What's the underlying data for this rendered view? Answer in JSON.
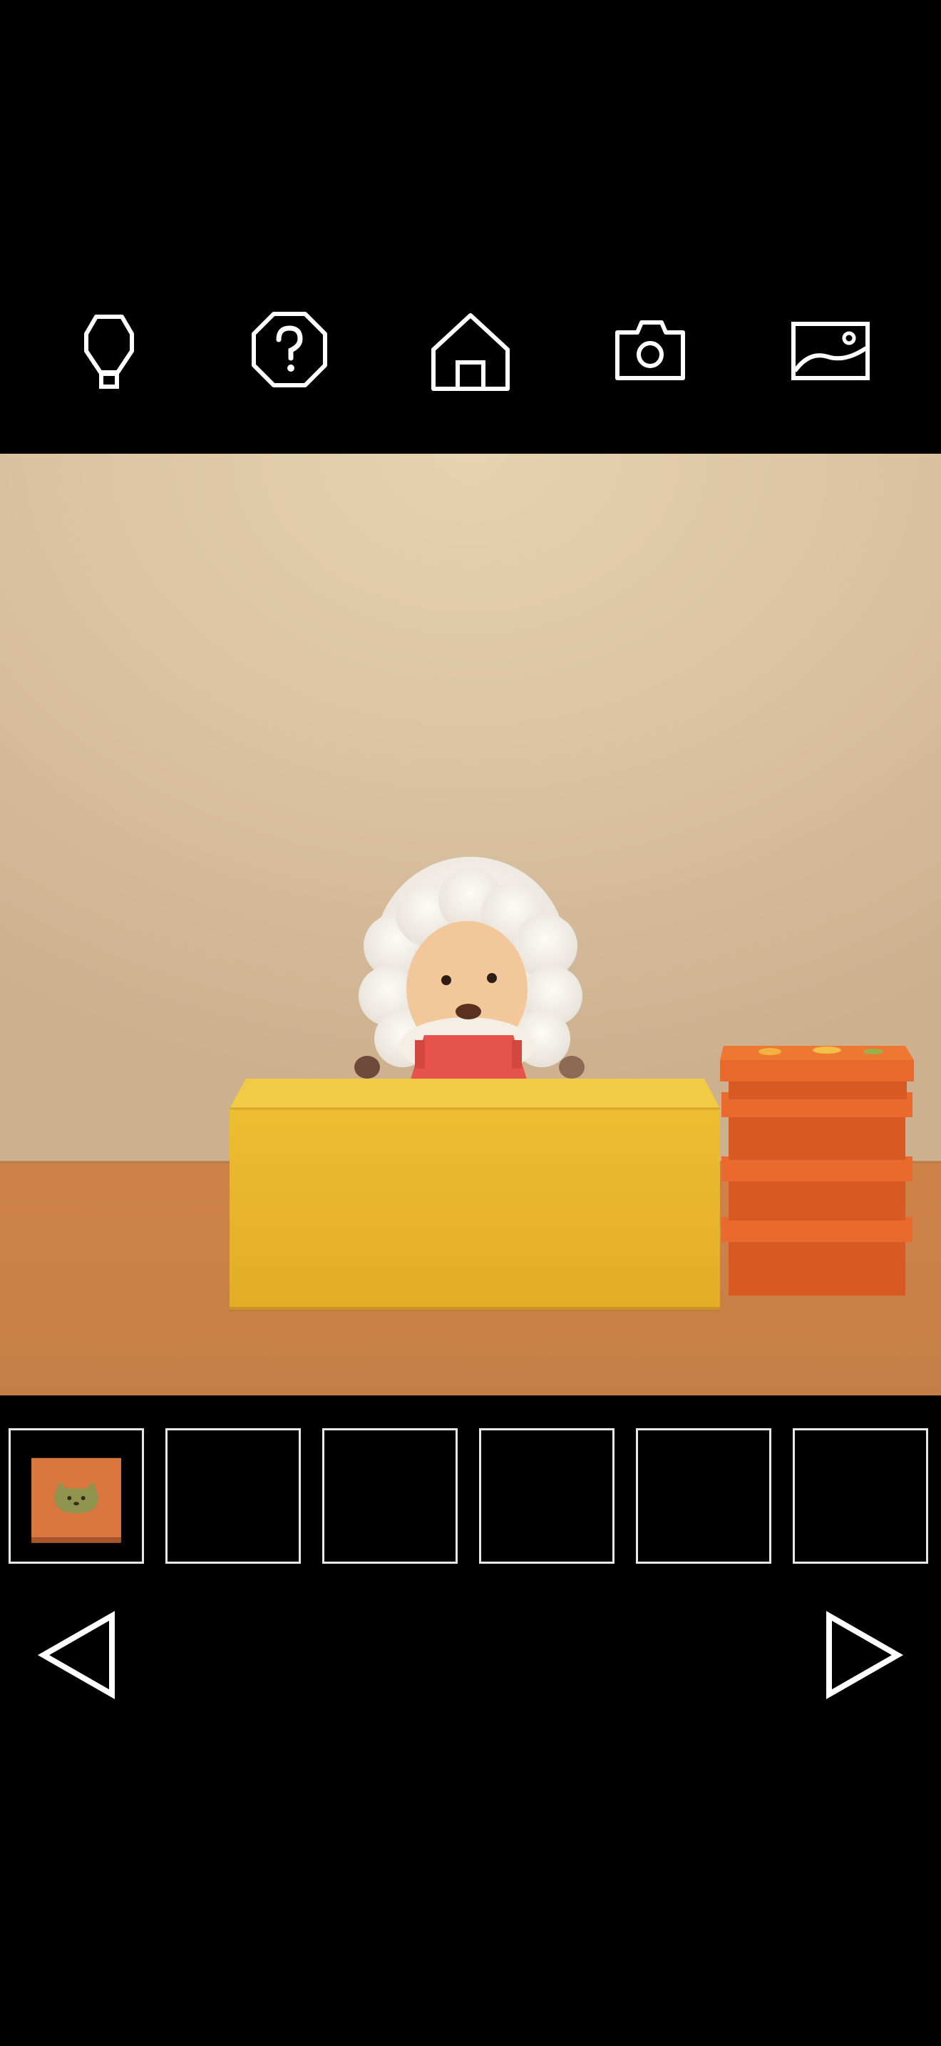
{
  "toolbar": {
    "items": [
      {
        "name": "hint",
        "icon": "lightbulb-icon"
      },
      {
        "name": "help",
        "icon": "question-octagon-icon"
      },
      {
        "name": "home",
        "icon": "home-icon"
      },
      {
        "name": "camera",
        "icon": "camera-icon"
      },
      {
        "name": "photos",
        "icon": "image-gallery-icon"
      }
    ]
  },
  "scene": {
    "description_items": [
      "sheep-figure",
      "yellow-box",
      "orange-box-stack"
    ],
    "colors": {
      "wall": "#d8bf9f",
      "floor": "#c97f45",
      "yellow_box": "#e9b92e",
      "orange_boxes": "#e4662a"
    }
  },
  "inventory": {
    "slots": [
      {
        "item": "orange-box-with-cat",
        "selected": false
      },
      {
        "item": null
      },
      {
        "item": null
      },
      {
        "item": null
      },
      {
        "item": null
      },
      {
        "item": null
      }
    ]
  },
  "navigation": {
    "left_icon": "triangle-left-icon",
    "right_icon": "triangle-right-icon"
  }
}
